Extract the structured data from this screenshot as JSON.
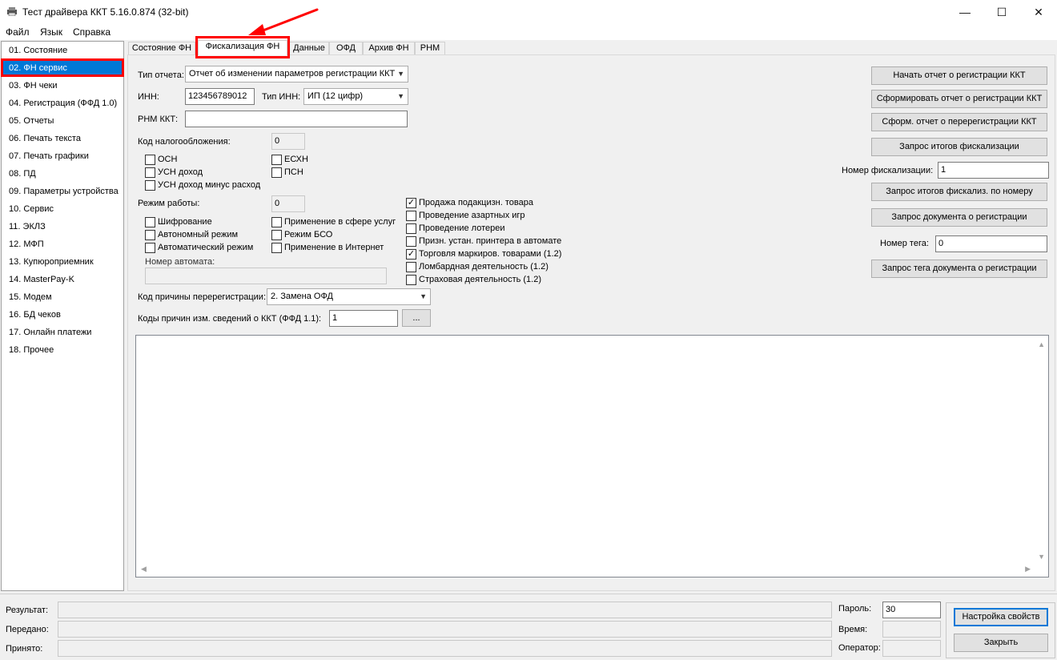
{
  "window": {
    "title": "Тест драйвера ККТ 5.16.0.874 (32-bit)",
    "minimize": "—",
    "maximize": "☐",
    "close": "✕"
  },
  "menu": [
    "Файл",
    "Язык",
    "Справка"
  ],
  "sidebar": {
    "items": [
      "01. Состояние",
      "02. ФН сервис",
      "03. ФН чеки",
      "04. Регистрация (ФФД 1.0)",
      "05. Отчеты",
      "06. Печать текста",
      "07. Печать графики",
      "08. ПД",
      "09. Параметры устройства",
      "10. Сервис",
      "11. ЭКЛЗ",
      "12. МФП",
      "13. Купюроприемник",
      "14. MasterPay-K",
      "15. Модем",
      "16. БД чеков",
      "17. Онлайн платежи",
      "18. Прочее"
    ],
    "selected_index": 1
  },
  "tabs": [
    "Состояние ФН",
    "Фискализация ФН",
    "Данные",
    "ОФД",
    "Архив ФН",
    "РНМ"
  ],
  "active_tab": 1,
  "form": {
    "report_type_label": "Тип отчета:",
    "report_type_value": "Отчет об изменении параметров регистрации ККТ",
    "inn_label": "ИНН:",
    "inn_value": "123456789012",
    "inn_type_label": "Тип ИНН:",
    "inn_type_value": "ИП (12 цифр)",
    "rnm_label": "РНМ ККТ:",
    "rnm_value": "",
    "tax_code_label": "Код налогообложения:",
    "tax_code_value": "0",
    "tax_options": [
      "ОСН",
      "ЕСХН",
      "УСН доход",
      "ПСН",
      "УСН доход минус расход"
    ],
    "work_mode_label": "Режим работы:",
    "work_mode_value": "0",
    "work_mode_options": [
      "Шифрование",
      "Применение в сфере услуг",
      "Автономный режим",
      "Режим БСО",
      "Автоматический режим",
      "Применение в Интернет"
    ],
    "automat_label": "Номер автомата:",
    "automat_value": "",
    "extra_options": [
      {
        "label": "Продажа подакцизн. товара",
        "checked": true
      },
      {
        "label": "Проведение азартных игр",
        "checked": false
      },
      {
        "label": "Проведение лотереи",
        "checked": false
      },
      {
        "label": "Призн. устан. принтера в автомате",
        "checked": false
      },
      {
        "label": "Торговля маркиров. товарами (1.2)",
        "checked": true
      },
      {
        "label": "Ломбардная деятельность (1.2)",
        "checked": false
      },
      {
        "label": "Страховая деятельность (1.2)",
        "checked": false
      }
    ],
    "rereg_reason_label": "Код причины перерегистрации:",
    "rereg_reason_value": "2. Замена ОФД",
    "change_codes_label": "Коды причин изм. сведений о ККТ (ФФД 1.1):",
    "change_codes_value": "1",
    "ellipsis": "..."
  },
  "right_panel": {
    "btn_start_report": "Начать отчет о регистрации ККТ",
    "btn_make_report": "Сформировать отчет о регистрации ККТ",
    "btn_make_rereg": "Сформ. отчет о перерегистрации ККТ",
    "btn_fisc_results": "Запрос итогов фискализации",
    "fisc_number_label": "Номер фискализации:",
    "fisc_number_value": "1",
    "btn_fisc_by_number": "Запрос итогов фискализ. по номеру",
    "btn_reg_doc": "Запрос документа о регистрации",
    "tag_number_label": "Номер тега:",
    "tag_number_value": "0",
    "btn_tag_doc": "Запрос тега документа о регистрации"
  },
  "status": {
    "result_label": "Результат:",
    "sent_label": "Передано:",
    "received_label": "Принято:",
    "password_label": "Пароль:",
    "password_value": "30",
    "time_label": "Время:",
    "operator_label": "Оператор:",
    "btn_settings": "Настройка свойств",
    "btn_close": "Закрыть"
  },
  "colors": {
    "selection": "#0078d7",
    "annotation": "#ff0000"
  }
}
